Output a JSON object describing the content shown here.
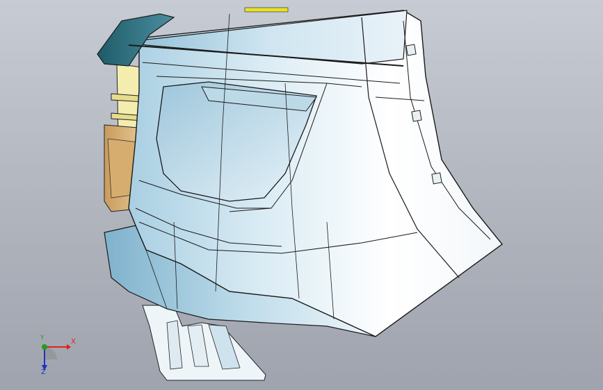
{
  "viewport": {
    "background_top": "#c7cbd3",
    "background_bottom": "#9fa3ad"
  },
  "triad": {
    "x_label": "X",
    "y_label": "Y",
    "z_label": "Z",
    "colors": {
      "x": "#e02020",
      "y": "#1fa01f",
      "z": "#2030c0"
    }
  },
  "model": {
    "name_icon": "car-quarter-panel-model",
    "colors": {
      "panel_light": "#f4f8fb",
      "panel_mid": "#cfe6f1",
      "panel_shadow": "#9cc3d9",
      "roof_trim": "#2d6f7d",
      "inner_yellow": "#f3eeb0",
      "inner_tan": "#d8b57c",
      "edge": "#1a1a1a",
      "highlight_yellow": "#e7e22a"
    }
  }
}
